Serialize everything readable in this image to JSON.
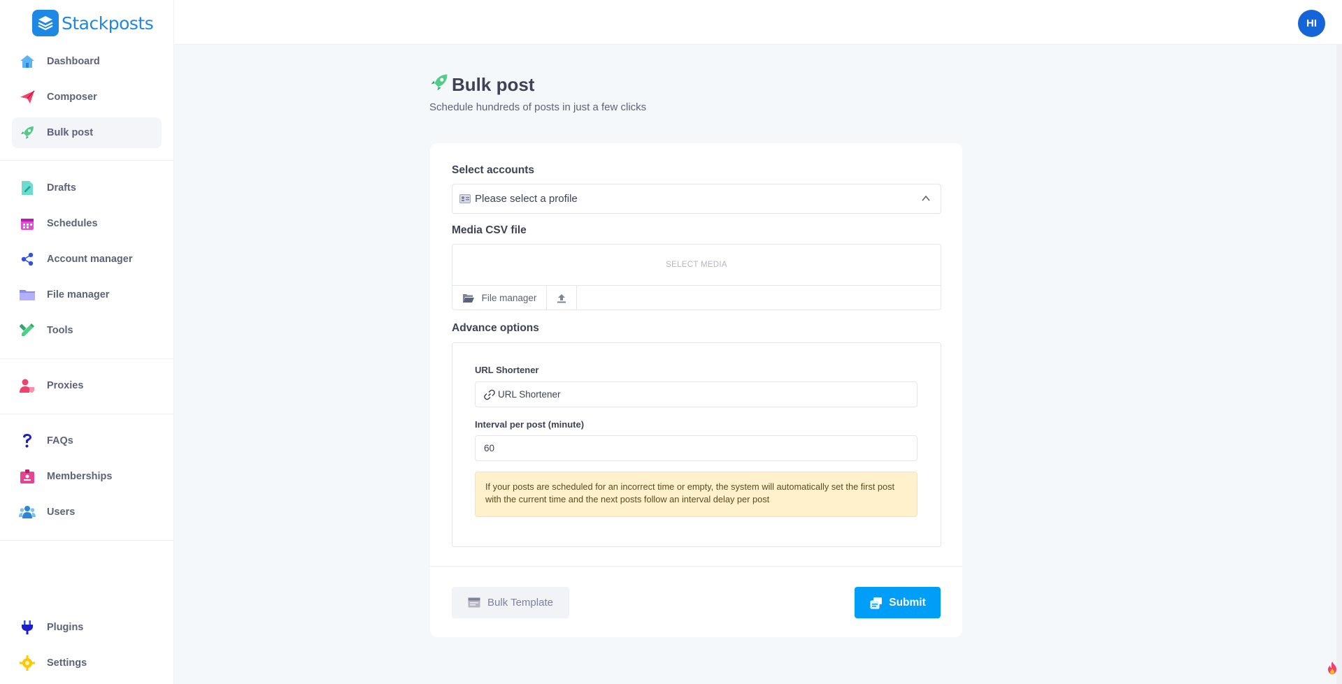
{
  "app": {
    "name": "Stackposts",
    "user_initials": "HI"
  },
  "sidebar": {
    "items": [
      {
        "label": "Dashboard",
        "icon": "home-icon"
      },
      {
        "label": "Composer",
        "icon": "paper-plane-icon"
      },
      {
        "label": "Bulk post",
        "icon": "rocket-icon"
      },
      {
        "label": "Drafts",
        "icon": "draft-doc-icon"
      },
      {
        "label": "Schedules",
        "icon": "calendar-icon"
      },
      {
        "label": "Account manager",
        "icon": "share-nodes-icon"
      },
      {
        "label": "File manager",
        "icon": "folder-icon"
      },
      {
        "label": "Tools",
        "icon": "pencil-ruler-icon"
      },
      {
        "label": "Proxies",
        "icon": "user-shield-icon"
      },
      {
        "label": "FAQs",
        "icon": "question-icon"
      },
      {
        "label": "Memberships",
        "icon": "id-badge-icon"
      },
      {
        "label": "Users",
        "icon": "users-icon"
      },
      {
        "label": "Plugins",
        "icon": "plug-icon"
      },
      {
        "label": "Settings",
        "icon": "gear-icon"
      }
    ],
    "active": "Bulk post"
  },
  "page": {
    "title": "Bulk post",
    "subtitle": "Schedule hundreds of posts in just a few clicks"
  },
  "form": {
    "accounts_label": "Select accounts",
    "accounts_placeholder": "Please select a profile",
    "media_label": "Media CSV file",
    "media_drop_text": "SELECT MEDIA",
    "file_manager_label": "File manager",
    "advance_label": "Advance options",
    "url_shortener_label": "URL Shortener",
    "url_shortener_value": "URL Shortener",
    "interval_label": "Interval per post (minute)",
    "interval_value": "60",
    "notice": "If your posts are scheduled for an incorrect time or empty, the system will automatically set the first post with the current time and the next posts follow an interval delay per post",
    "bulk_template_label": "Bulk Template",
    "submit_label": "Submit"
  },
  "colors": {
    "brand": "#1e88e5",
    "submit": "#009ef7",
    "notice_bg": "#fff1cc",
    "avatar": "#1565d8"
  }
}
